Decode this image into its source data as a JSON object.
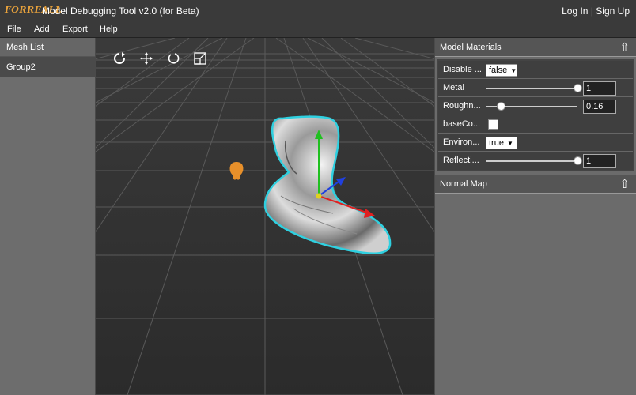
{
  "app": {
    "logo": "FORREALL",
    "title": "Model Debugging Tool v2.0 (for Beta)",
    "login": "Log In",
    "separator": "|",
    "signup": "Sign Up"
  },
  "menu": [
    "File",
    "Add",
    "Export",
    "Help"
  ],
  "left_panel": {
    "header": "Mesh List",
    "items": [
      "Group2"
    ]
  },
  "toolbar": {
    "icons": [
      "rotate-icon",
      "move-icon",
      "refresh-icon",
      "scale-icon"
    ]
  },
  "right_panel": {
    "model_materials": {
      "title": "Model Materials",
      "collapse_icon": "up-arrow-icon",
      "rows": [
        {
          "label": "Disable ...",
          "type": "select",
          "value": "false"
        },
        {
          "label": "Metal",
          "type": "slider",
          "value": "1",
          "level": 1.0
        },
        {
          "label": "Roughn...",
          "type": "slider",
          "value": "0.16",
          "level": 0.16
        },
        {
          "label": "baseCo...",
          "type": "color",
          "value": "#ffffff"
        },
        {
          "label": "Environ...",
          "type": "select",
          "value": "true"
        },
        {
          "label": "Reflecti...",
          "type": "slider",
          "value": "1",
          "level": 1.0
        }
      ]
    },
    "normal_map": {
      "title": "Normal Map",
      "collapse_icon": "up-arrow-icon"
    }
  },
  "colors": {
    "accent_logo": "#e8a23c",
    "selection_outline": "#2fd0e0",
    "gizmo_x": "#e02020",
    "gizmo_y": "#20c020",
    "gizmo_z": "#2040e0",
    "light_marker": "#e8902a"
  }
}
